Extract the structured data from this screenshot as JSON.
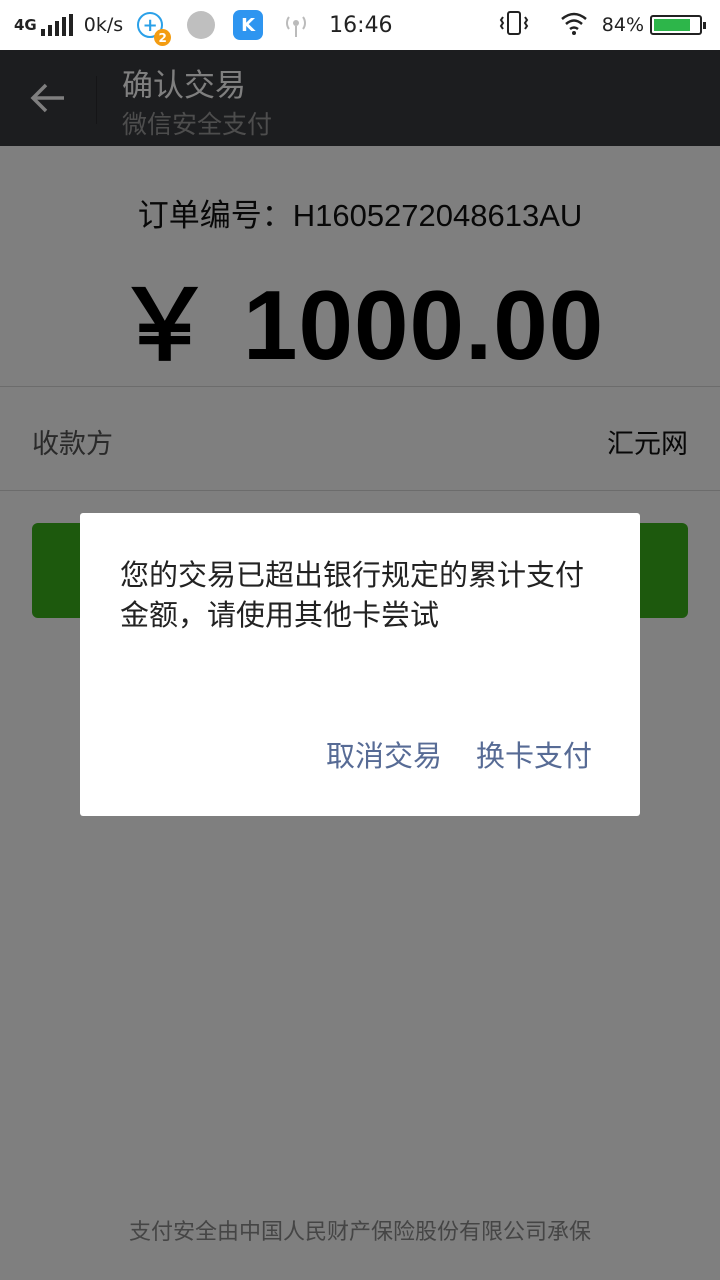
{
  "status_bar": {
    "network": "4G",
    "speed": "0k/s",
    "notification_badge": "2",
    "app_letter": "K",
    "time": "16:46",
    "battery_percent": "84%",
    "battery_level": 0.84
  },
  "header": {
    "title": "确认交易",
    "subtitle": "微信安全支付"
  },
  "order": {
    "label": "订单编号：",
    "number": "H1605272048613AU",
    "amount": "￥ 1000.00"
  },
  "payee": {
    "label": "收款方",
    "value": "汇元网"
  },
  "dialog": {
    "message": "您的交易已超出银行规定的累计支付金额，请使用其他卡尝试",
    "cancel_label": "取消交易",
    "switch_label": "换卡支付"
  },
  "footer": {
    "text": "支付安全由中国人民财产保险股份有限公司承保"
  },
  "colors": {
    "titlebar": "#393a3f",
    "pay_button": "#3bb31b",
    "dialog_link": "#576b95"
  }
}
